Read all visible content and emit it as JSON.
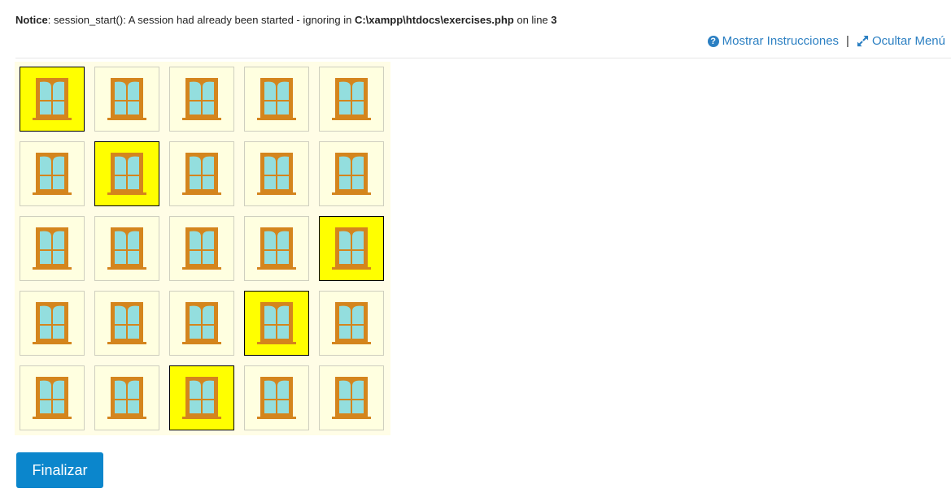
{
  "notice": {
    "label": "Notice",
    "message_before": ": session_start(): A session had already been started - ignoring in ",
    "file": "C:\\xampp\\htdocs\\exercises.php",
    "message_middle": " on line ",
    "line": "3"
  },
  "toplinks": {
    "show_instructions": "Mostrar Instrucciones",
    "separator": "|",
    "hide_menu": "Ocultar Menú"
  },
  "grid": {
    "rows": 5,
    "cols": 5,
    "icon": "window-icon",
    "selected": [
      [
        0,
        0
      ],
      [
        1,
        1
      ],
      [
        2,
        4
      ],
      [
        3,
        3
      ],
      [
        4,
        2
      ]
    ]
  },
  "colors": {
    "window_frame": "#d4851d",
    "window_glass": "#93dede",
    "cell_bg": "#ffffe0",
    "cell_selected": "#ffff00",
    "button_bg": "#0b86cc",
    "link": "#2b7fc2"
  },
  "finish_button": {
    "label": "Finalizar"
  }
}
